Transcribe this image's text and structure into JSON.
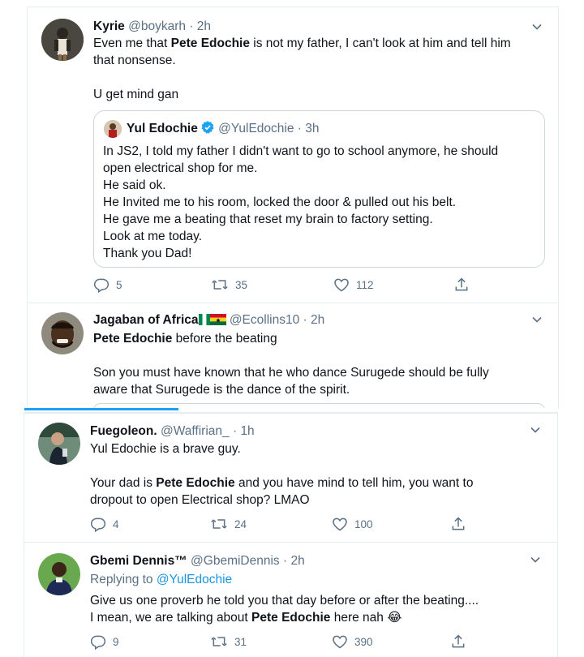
{
  "tweets": [
    {
      "name": "Kyrie",
      "handle": "@boykarh",
      "sep": "·",
      "time": "2h",
      "line1_a": "Even me that ",
      "line1_b": "Pete Edochie",
      "line1_c": " is not my father, I can't look at him and tell him",
      "line2": "that nonsense.",
      "line3": "U get mind gan",
      "quote": {
        "name": "Yul Edochie",
        "handle": "@YulEdochie",
        "time": "3h",
        "lines": [
          "In JS2, I told my father I didn't want to go to school anymore, he should",
          "open electrical shop for me.",
          "He said ok.",
          "He Invited me to his room, locked the door & pulled out his belt.",
          "He gave me a beating that reset my brain to factory setting.",
          "Look at me today.",
          "Thank you Dad!"
        ]
      },
      "replies": "5",
      "retweets": "35",
      "likes": "112"
    },
    {
      "name": "Jagaban of Africa",
      "handle": "@Ecollins10",
      "time": "2h",
      "line1_b": "Pete Edochie",
      "line1_c": " before the beating",
      "line2": "Son you must have known that he who dance Surugede should be fully",
      "line3": "aware that Surugede is the dance of the spirit."
    },
    {
      "name": "Fuegoleon.",
      "handle": "@Waffirian_",
      "time": "1h",
      "line1": "Yul Edochie is a brave guy.",
      "line2_a": "Your dad is ",
      "line2_b": "Pete Edochie",
      "line2_c": " and you have mind to tell him, you want to",
      "line3": "dropout to open Electrical shop? LMAO",
      "replies": "4",
      "retweets": "24",
      "likes": "100"
    },
    {
      "name": "Gbemi Dennis™",
      "handle": "@GbemiDennis",
      "time": "2h",
      "replying_prefix": "Replying to ",
      "replying_to": "@YulEdochie",
      "line1": "Give us one proverb he told you that day before or after the beating....",
      "line2_a": "I mean, we are talking about ",
      "line2_b": "Pete Edochie",
      "line2_c": " here nah ",
      "emoji": "😂",
      "replies": "9",
      "retweets": "31",
      "likes": "390"
    }
  ],
  "colors": {
    "accent": "#1da1f2",
    "muted": "#5b7083",
    "text": "#0f1419",
    "border": "#e6ecf0"
  },
  "icons": [
    "reply-icon",
    "retweet-icon",
    "like-icon",
    "share-icon",
    "chevron-down-icon",
    "verified-badge-icon"
  ]
}
